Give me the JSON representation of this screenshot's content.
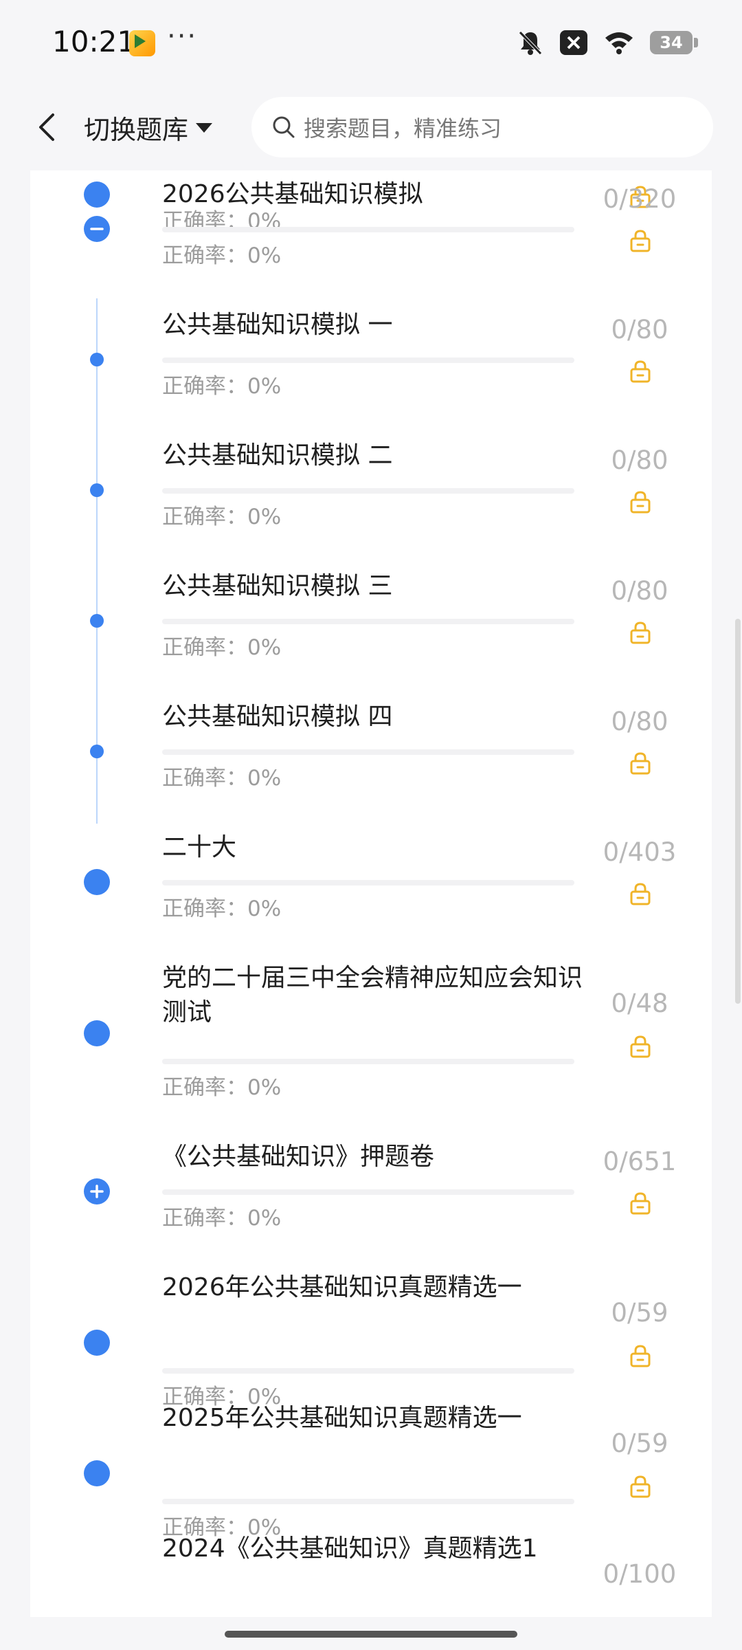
{
  "status_bar": {
    "time": "10:21",
    "more": "···",
    "battery": "34"
  },
  "header": {
    "switch_label": "切换题库",
    "search_placeholder": "搜索题目，精准练习"
  },
  "accuracy_prefix": "正确率：",
  "rows": [
    {
      "title": "",
      "accuracy": "0%",
      "count": "",
      "locked": true,
      "marker": "big"
    },
    {
      "title": "2026公共基础知识模拟",
      "accuracy": "0%",
      "count": "0/320",
      "locked": true,
      "marker": "collapse"
    },
    {
      "title": "公共基础知识模拟 一",
      "accuracy": "0%",
      "count": "0/80",
      "locked": true,
      "marker": "small"
    },
    {
      "title": "公共基础知识模拟 二",
      "accuracy": "0%",
      "count": "0/80",
      "locked": true,
      "marker": "small"
    },
    {
      "title": "公共基础知识模拟 三",
      "accuracy": "0%",
      "count": "0/80",
      "locked": true,
      "marker": "small"
    },
    {
      "title": "公共基础知识模拟 四",
      "accuracy": "0%",
      "count": "0/80",
      "locked": true,
      "marker": "small"
    },
    {
      "title": "二十大",
      "accuracy": "0%",
      "count": "0/403",
      "locked": true,
      "marker": "big"
    },
    {
      "title": "党的二十届三中全会精神应知应会知识测试",
      "accuracy": "0%",
      "count": "0/48",
      "locked": true,
      "marker": "big"
    },
    {
      "title": "《公共基础知识》押题卷",
      "accuracy": "0%",
      "count": "0/651",
      "locked": true,
      "marker": "expand"
    },
    {
      "title": "2026年公共基础知识真题精选一",
      "accuracy": "0%",
      "count": "0/59",
      "locked": true,
      "marker": "big"
    },
    {
      "title": "2025年公共基础知识真题精选一",
      "accuracy": "0%",
      "count": "0/59",
      "locked": true,
      "marker": "big"
    },
    {
      "title": "2024《公共基础知识》真题精选1",
      "accuracy": "",
      "count": "0/100",
      "locked": false,
      "marker": "none"
    }
  ],
  "colors": {
    "accent": "#3b82f0",
    "lock": "#f0b429",
    "count": "#b7b7b7"
  }
}
